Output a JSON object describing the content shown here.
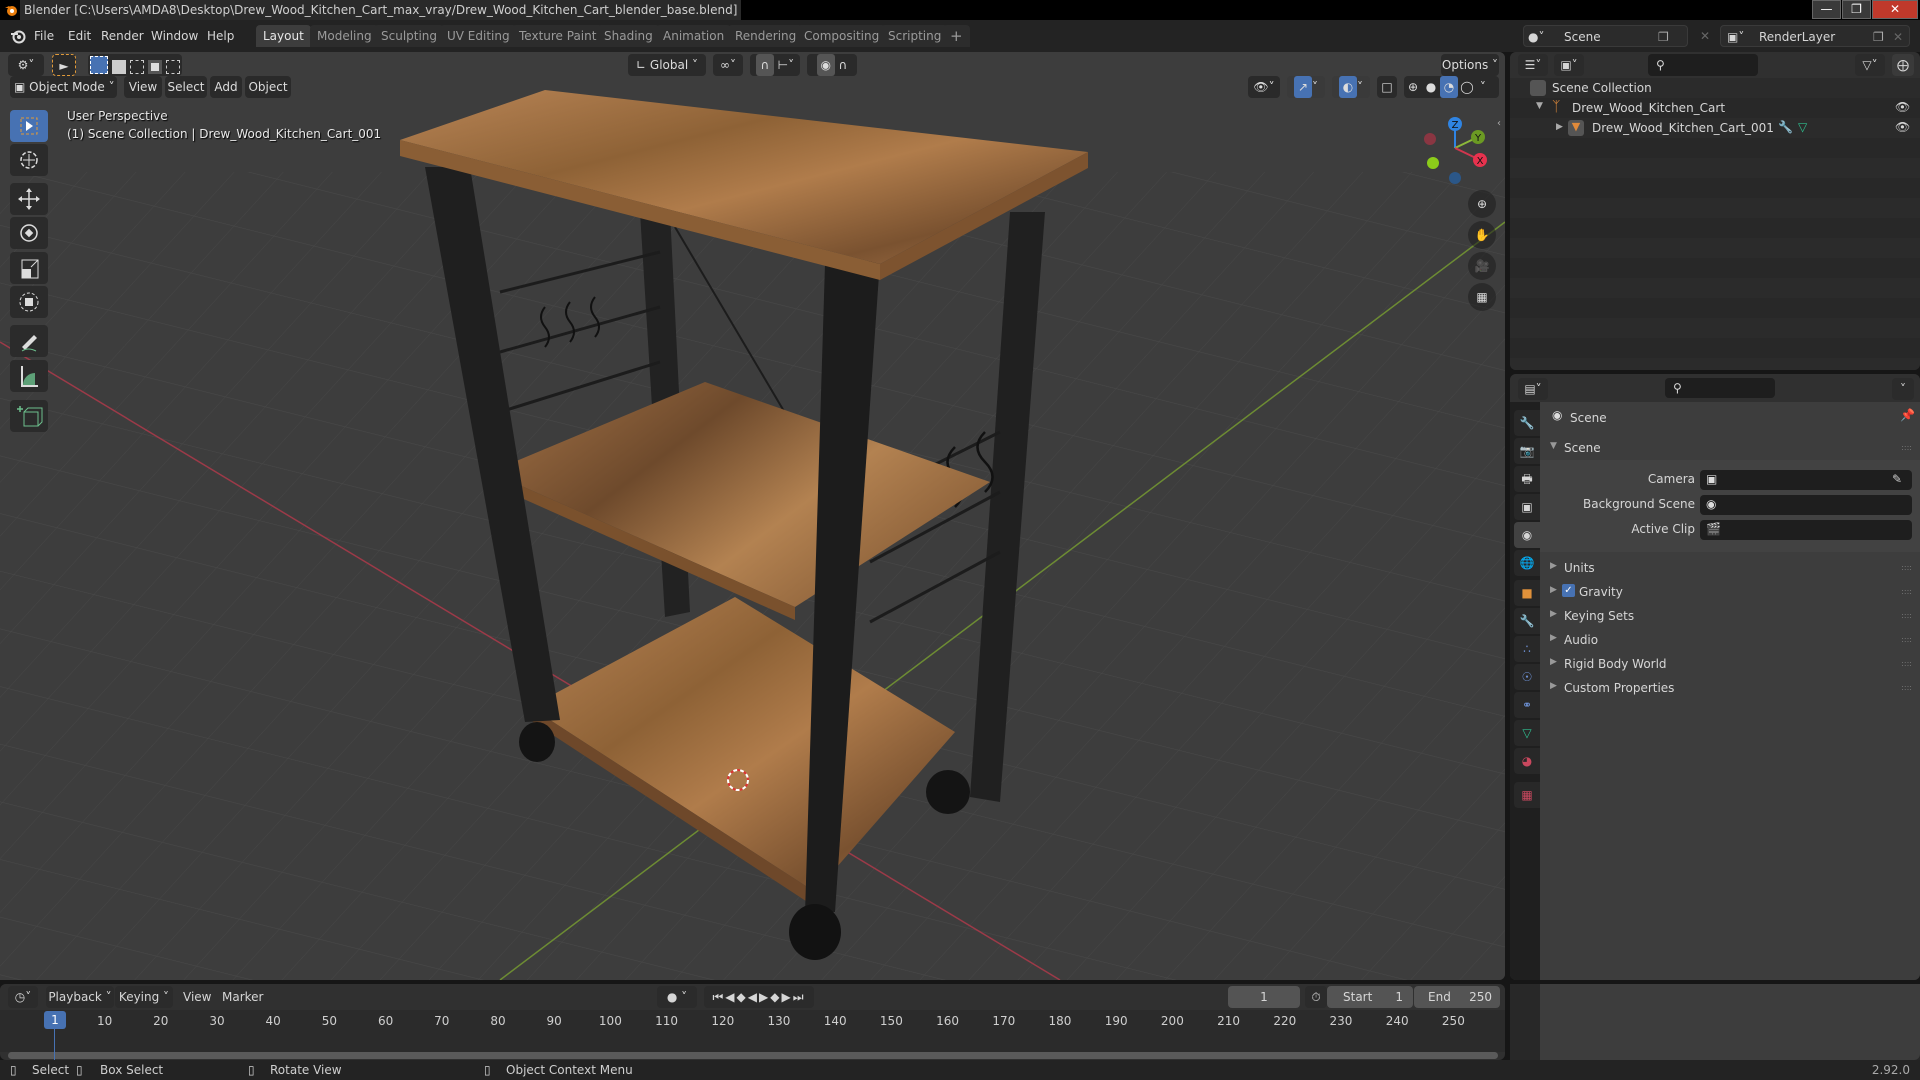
{
  "window": {
    "title": "Blender [C:\\Users\\AMDA8\\Desktop\\Drew_Wood_Kitchen_Cart_max_vray/Drew_Wood_Kitchen_Cart_blender_base.blend]",
    "controls": [
      "minimize",
      "maximize",
      "close"
    ]
  },
  "menu": {
    "items": [
      "File",
      "Edit",
      "Render",
      "Window",
      "Help"
    ]
  },
  "workspaces": {
    "tabs": [
      {
        "label": "Layout",
        "active": true
      },
      {
        "label": "Modeling",
        "active": false
      },
      {
        "label": "Sculpting",
        "active": false
      },
      {
        "label": "UV Editing",
        "active": false
      },
      {
        "label": "Texture Paint",
        "active": false
      },
      {
        "label": "Shading",
        "active": false
      },
      {
        "label": "Animation",
        "active": false
      },
      {
        "label": "Rendering",
        "active": false
      },
      {
        "label": "Compositing",
        "active": false
      },
      {
        "label": "Scripting",
        "active": false
      }
    ],
    "add_label": "+"
  },
  "scene_selector": {
    "value": "Scene"
  },
  "view_layer_selector": {
    "value": "RenderLayer"
  },
  "viewport": {
    "header": {
      "mode": "Object Mode",
      "menus": [
        "View",
        "Select",
        "Add",
        "Object"
      ],
      "transform_orientation": "Global",
      "options_label": "Options"
    },
    "overlay_text": {
      "view_name": "User Perspective",
      "collection_info": "(1) Scene Collection | Drew_Wood_Kitchen_Cart_001"
    },
    "gizmo_axes": [
      "X",
      "Y",
      "Z"
    ],
    "tools": [
      "select-box",
      "cursor",
      "move",
      "rotate",
      "scale",
      "transform",
      "annotate",
      "measure",
      "add-cube"
    ],
    "nav_buttons": [
      "zoom",
      "pan",
      "camera",
      "perspective-toggle"
    ],
    "colors": {
      "x_axis": "#d0364e",
      "y_axis": "#8cb83a",
      "z_axis": "#2f84e3",
      "active_tool": "#4772b3",
      "wood": "#a8774a",
      "metal": "#1e1e1e"
    }
  },
  "outliner": {
    "root": "Scene Collection",
    "items": [
      {
        "label": "Drew_Wood_Kitchen_Cart",
        "type": "empty",
        "expanded": true,
        "visible": true
      },
      {
        "label": "Drew_Wood_Kitchen_Cart_001",
        "type": "mesh",
        "expanded": false,
        "visible": true,
        "has_modifier": true,
        "has_mesh_data": true
      }
    ]
  },
  "properties": {
    "context_title": "Scene",
    "section_title": "Scene",
    "fields": [
      {
        "label": "Camera",
        "value": ""
      },
      {
        "label": "Background Scene",
        "value": ""
      },
      {
        "label": "Active Clip",
        "value": ""
      }
    ],
    "panels": [
      {
        "label": "Units",
        "checkbox": null
      },
      {
        "label": "Gravity",
        "checkbox": true
      },
      {
        "label": "Keying Sets",
        "checkbox": null
      },
      {
        "label": "Audio",
        "checkbox": null
      },
      {
        "label": "Rigid Body World",
        "checkbox": null
      },
      {
        "label": "Custom Properties",
        "checkbox": null
      }
    ],
    "tabs": [
      "tool",
      "render",
      "output",
      "view-layer",
      "scene",
      "world",
      "object",
      "modifiers",
      "particles",
      "physics",
      "constraints",
      "data",
      "material",
      "texture"
    ],
    "active_tab": "scene"
  },
  "timeline": {
    "menus": [
      "Playback",
      "Keying",
      "View",
      "Marker"
    ],
    "current_frame": "1",
    "start_label": "Start",
    "start": "1",
    "end_label": "End",
    "end": "250",
    "ruler": [
      "10",
      "20",
      "30",
      "40",
      "50",
      "60",
      "70",
      "80",
      "90",
      "100",
      "110",
      "120",
      "130",
      "140",
      "150",
      "160",
      "170",
      "180",
      "190",
      "200",
      "210",
      "220",
      "230",
      "240",
      "250"
    ],
    "playhead_label": "1"
  },
  "statusbar": {
    "hints": [
      {
        "key": "left-mouse",
        "label": "Select"
      },
      {
        "key": "left-drag",
        "label": "Box Select"
      },
      {
        "key": "middle-mouse",
        "label": "Rotate View"
      },
      {
        "key": "right-mouse",
        "label": "Object Context Menu"
      }
    ],
    "version": "2.92.0"
  }
}
